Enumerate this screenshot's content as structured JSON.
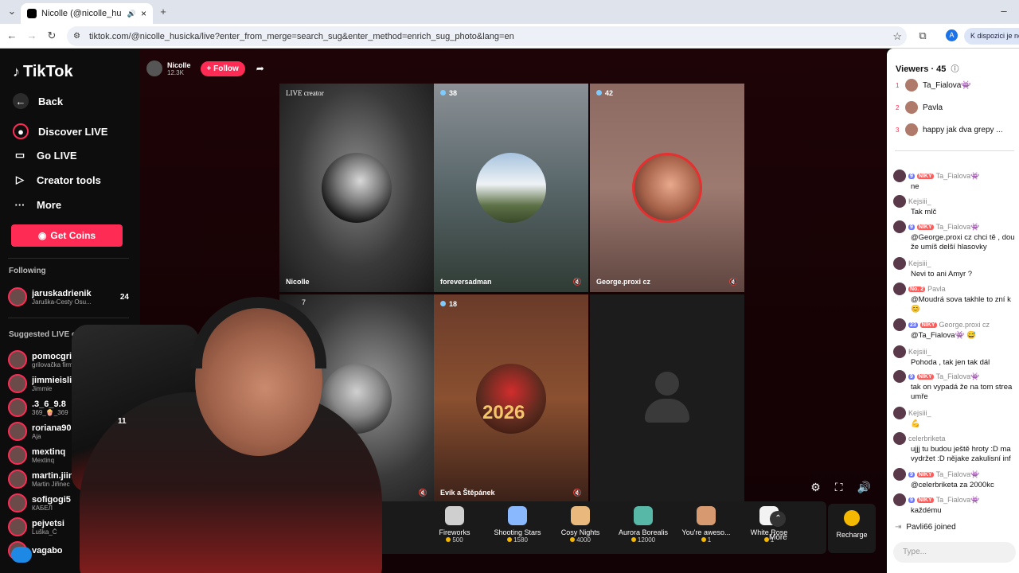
{
  "browser": {
    "tab_title": "Nicolle (@nicolle_hu",
    "url": "tiktok.com/@nicolle_husicka/live?enter_from_merge=search_sug&enter_method=enrich_sug_photo&lang=en",
    "profile_initial": "A",
    "side_text": "K dispozici je nov"
  },
  "sidebar": {
    "logo": "TikTok",
    "back": "Back",
    "nav": [
      "Discover LIVE",
      "Go LIVE",
      "Creator tools",
      "More"
    ],
    "get_coins": "Get Coins",
    "following_title": "Following",
    "following": [
      {
        "name": "jaruskadrienik",
        "sub": "Jaruška-Cesty Osu...",
        "count": "24"
      }
    ],
    "suggested_title": "Suggested LIVE creators",
    "suggested": [
      {
        "name": "pomocgrilov...",
        "sub": "grilovačka firma s..."
      },
      {
        "name": "jimmieislive",
        "sub": "Jimmie"
      },
      {
        "name": ".3_6_9.8",
        "sub": "369_🍿_369"
      },
      {
        "name": "roriana90",
        "sub": "Aja"
      },
      {
        "name": "mextinq",
        "sub": "Mextinq"
      },
      {
        "name": "martin.jiine",
        "sub": "Martin Jiřinec"
      },
      {
        "name": "sofigogi5",
        "sub": "КАБЕЛ"
      },
      {
        "name": "pejvetsi",
        "sub": "Luška_Č"
      },
      {
        "name": "vagabo",
        "sub": ""
      }
    ]
  },
  "host": {
    "name": "Nicolle",
    "likes": "12.3K",
    "follow": "+ Follow"
  },
  "tiles": [
    {
      "label_top": "LIVE creator",
      "name": "Nicolle",
      "count": ""
    },
    {
      "label_top": "",
      "name": "foreversadman",
      "count": "38"
    },
    {
      "label_top": "",
      "name": "George.proxi cz",
      "count": "42"
    },
    {
      "label_top": "",
      "name": "",
      "count": ""
    },
    {
      "label_top": "",
      "name": "Evík a Štěpánek",
      "count": "18"
    },
    {
      "label_top": "",
      "name": "",
      "count": ""
    }
  ],
  "tile_overlay": {
    "badge_11": "11",
    "tile4_prefix": "7"
  },
  "gifts": [
    {
      "name": "Fireworks",
      "price": "500"
    },
    {
      "name": "Shooting Stars",
      "price": "1580"
    },
    {
      "name": "Cosy Nights",
      "price": "4000"
    },
    {
      "name": "Aurora Borealis",
      "price": "12000"
    },
    {
      "name": "You're aweso...",
      "price": "1"
    },
    {
      "name": "White Rose",
      "price": "1"
    }
  ],
  "more_label": "More",
  "recharge_label": "Recharge",
  "chat": {
    "viewers_title": "Viewers · 45",
    "viewers": [
      {
        "rank": "1",
        "name": "Ta_Fialova👾"
      },
      {
        "rank": "2",
        "name": "Pavla"
      },
      {
        "rank": "3",
        "name": "happy jak dva grepy ..."
      }
    ],
    "messages": [
      {
        "user": "Ta_Fialova👾",
        "badges": [
          "9",
          "NIKY"
        ],
        "text": "ne"
      },
      {
        "user": "Kejsiii_",
        "badges": [],
        "text": "Tak mlč"
      },
      {
        "user": "Ta_Fialova👾",
        "badges": [
          "9",
          "NIKY"
        ],
        "text": "@George.proxi cz chci tě , dou že umíš delší hlasovky"
      },
      {
        "user": "Kejsiii_",
        "badges": [],
        "text": "Nevi to ani Amyr ?"
      },
      {
        "user": "Pavla",
        "badges": [
          "No. 2"
        ],
        "text": "@Moudrá sova takhle to zní k 😊"
      },
      {
        "user": "George.proxi cz",
        "badges": [
          "23",
          "NIKY"
        ],
        "text": "@Ta_Fialova👾 😅"
      },
      {
        "user": "Kejsiii_",
        "badges": [],
        "text": "Pohoda , tak jen tak dál"
      },
      {
        "user": "Ta_Fialova👾",
        "badges": [
          "9",
          "NIKY"
        ],
        "text": "tak on vypadá že na tom strea umře"
      },
      {
        "user": "Kejsiii_",
        "badges": [],
        "text": "💪"
      },
      {
        "user": "celerbriketa",
        "badges": [],
        "text": "ujjj tu budou ještě hroty :D ma vydržet :D nějake zakulisní inf"
      },
      {
        "user": "Ta_Fialova👾",
        "badges": [
          "9",
          "NIKY"
        ],
        "text": "@celerbriketa za 2000kc"
      },
      {
        "user": "Ta_Fialova👾",
        "badges": [
          "9",
          "NIKY"
        ],
        "text": "každému"
      }
    ],
    "joined": "Pavli66 joined",
    "input_placeholder": "Type..."
  }
}
